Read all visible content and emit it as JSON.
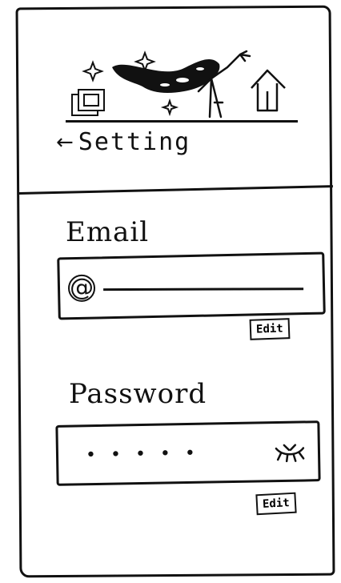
{
  "header": {
    "back_icon": "arrow-left-icon",
    "title": "Setting"
  },
  "email": {
    "label": "Email",
    "at_symbol": "@",
    "value": "",
    "edit_label": "Edit"
  },
  "password": {
    "label": "Password",
    "masked_value": "•••••",
    "toggle_icon": "eye-closed-icon",
    "edit_label": "Edit"
  }
}
